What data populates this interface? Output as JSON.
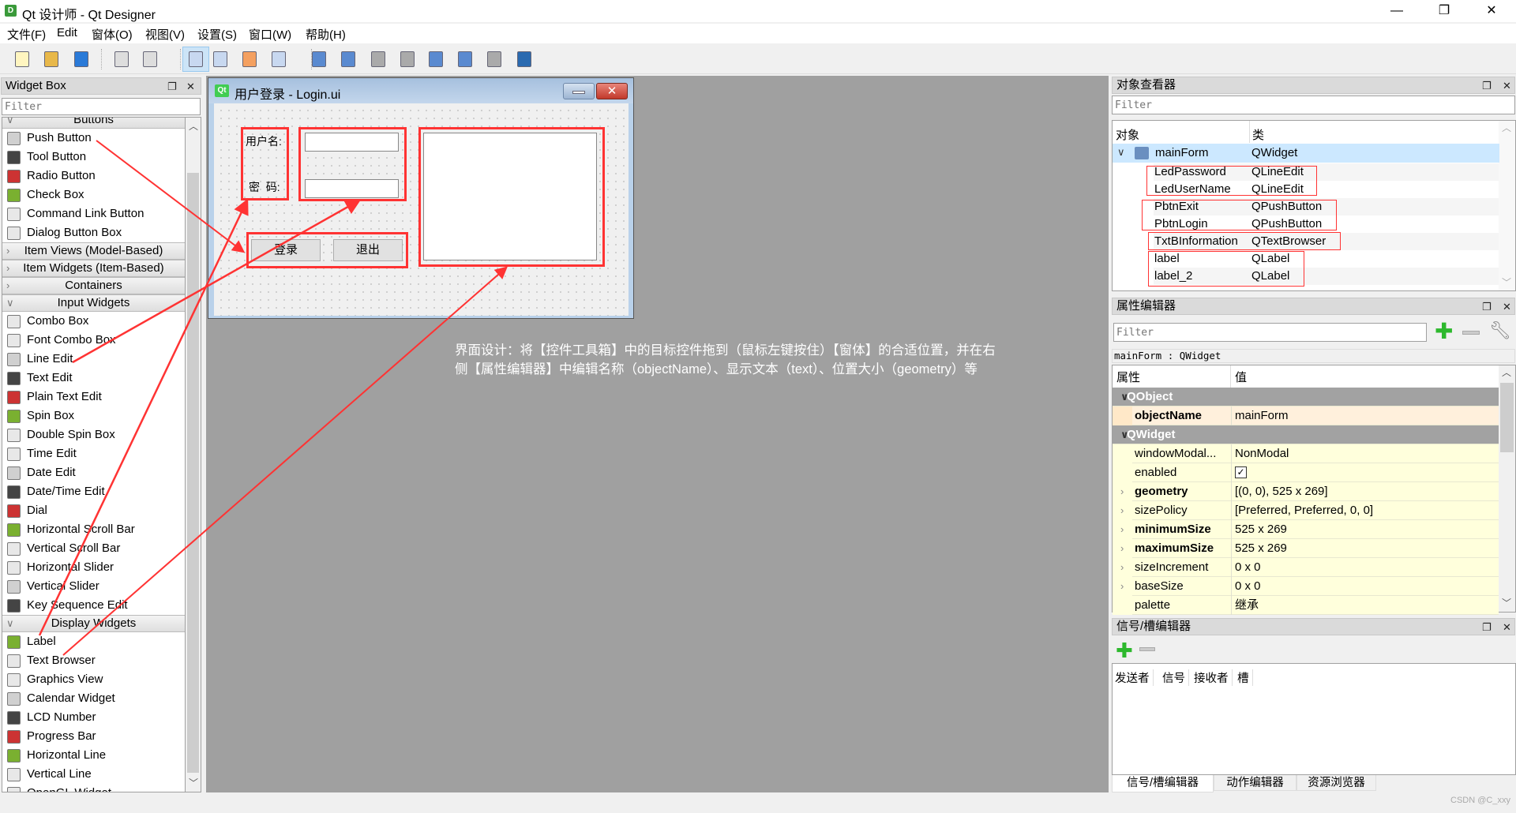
{
  "window": {
    "title": "Qt 设计师 - Qt Designer",
    "icon": "qt-designer-icon",
    "minimize": "—",
    "restore": "❐",
    "close": "✕"
  },
  "menu": [
    "文件(F)",
    "Edit",
    "窗体(O)",
    "视图(V)",
    "设置(S)",
    "窗口(W)",
    "帮助(H)"
  ],
  "toolbar": [
    {
      "icon": "new-file-icon"
    },
    {
      "icon": "open-folder-icon"
    },
    {
      "icon": "save-icon"
    },
    {
      "icon": "bring-front-icon"
    },
    {
      "icon": "send-back-icon"
    },
    {
      "icon": "edit-widgets-icon",
      "active": true
    },
    {
      "icon": "edit-signals-slots-icon"
    },
    {
      "icon": "edit-buddies-icon"
    },
    {
      "icon": "edit-tab-order-icon"
    },
    {
      "icon": "layout-horizontal-icon"
    },
    {
      "icon": "layout-vertical-icon"
    },
    {
      "icon": "layout-h-splitter-icon"
    },
    {
      "icon": "layout-v-splitter-icon"
    },
    {
      "icon": "layout-grid-icon"
    },
    {
      "icon": "layout-form-icon"
    },
    {
      "icon": "break-layout-icon"
    },
    {
      "icon": "adjust-size-icon"
    }
  ],
  "widget_box": {
    "title": "Widget Box",
    "filter_placeholder": "Filter",
    "items": [
      {
        "cat": "Buttons",
        "open": true
      },
      {
        "label": "Push Button",
        "icon": "push-button-icon"
      },
      {
        "label": "Tool Button",
        "icon": "tool-button-icon"
      },
      {
        "label": "Radio Button",
        "icon": "radio-button-icon"
      },
      {
        "label": "Check Box",
        "icon": "check-box-icon"
      },
      {
        "label": "Command Link Button",
        "icon": "command-link-icon"
      },
      {
        "label": "Dialog Button Box",
        "icon": "dialog-button-box-icon"
      },
      {
        "cat": "Item Views (Model-Based)",
        "open": false
      },
      {
        "cat": "Item Widgets (Item-Based)",
        "open": false
      },
      {
        "cat": "Containers",
        "open": false
      },
      {
        "cat": "Input Widgets",
        "open": true
      },
      {
        "label": "Combo Box",
        "icon": "combo-box-icon"
      },
      {
        "label": "Font Combo Box",
        "icon": "font-combo-box-icon"
      },
      {
        "label": "Line Edit",
        "icon": "line-edit-icon"
      },
      {
        "label": "Text Edit",
        "icon": "text-edit-icon"
      },
      {
        "label": "Plain Text Edit",
        "icon": "plain-text-edit-icon"
      },
      {
        "label": "Spin Box",
        "icon": "spin-box-icon"
      },
      {
        "label": "Double Spin Box",
        "icon": "double-spin-box-icon"
      },
      {
        "label": "Time Edit",
        "icon": "time-edit-icon"
      },
      {
        "label": "Date Edit",
        "icon": "date-edit-icon"
      },
      {
        "label": "Date/Time Edit",
        "icon": "date-time-edit-icon"
      },
      {
        "label": "Dial",
        "icon": "dial-icon"
      },
      {
        "label": "Horizontal Scroll Bar",
        "icon": "horizontal-scroll-bar-icon"
      },
      {
        "label": "Vertical Scroll Bar",
        "icon": "vertical-scroll-bar-icon"
      },
      {
        "label": "Horizontal Slider",
        "icon": "horizontal-slider-icon"
      },
      {
        "label": "Vertical Slider",
        "icon": "vertical-slider-icon"
      },
      {
        "label": "Key Sequence Edit",
        "icon": "key-sequence-edit-icon"
      },
      {
        "cat": "Display Widgets",
        "open": true
      },
      {
        "label": "Label",
        "icon": "label-icon"
      },
      {
        "label": "Text Browser",
        "icon": "text-browser-icon"
      },
      {
        "label": "Graphics View",
        "icon": "graphics-view-icon"
      },
      {
        "label": "Calendar Widget",
        "icon": "calendar-icon"
      },
      {
        "label": "LCD Number",
        "icon": "lcd-number-icon"
      },
      {
        "label": "Progress Bar",
        "icon": "progress-bar-icon"
      },
      {
        "label": "Horizontal Line",
        "icon": "horizontal-line-icon"
      },
      {
        "label": "Vertical Line",
        "icon": "vertical-line-icon"
      },
      {
        "label": "OpenGL Widget",
        "icon": "opengl-widget-icon"
      }
    ]
  },
  "form": {
    "title": "用户登录 - Login.ui",
    "username_label": "用户名:",
    "password_label": "密  码:",
    "login_button": "登录",
    "exit_button": "退出"
  },
  "annotation": {
    "line1": "界面设计：将【控件工具箱】中的目标控件拖到（鼠标左键按住）【窗体】的合适位置，并在右",
    "line2": "侧【属性编辑器】中编辑名称（objectName）、显示文本（text）、位置大小（geometry）等",
    "color": "#ff3333"
  },
  "object_inspector": {
    "title": "对象查看器",
    "filter_placeholder": "Filter",
    "col_object": "对象",
    "col_class": "类",
    "root": {
      "name": "mainForm",
      "class": "QWidget"
    },
    "children": [
      {
        "name": "LedPassword",
        "class": "QLineEdit"
      },
      {
        "name": "LedUserName",
        "class": "QLineEdit"
      },
      {
        "name": "PbtnExit",
        "class": "QPushButton"
      },
      {
        "name": "PbtnLogin",
        "class": "QPushButton"
      },
      {
        "name": "TxtBInformation",
        "class": "QTextBrowser"
      },
      {
        "name": "label",
        "class": "QLabel"
      },
      {
        "name": "label_2",
        "class": "QLabel"
      }
    ]
  },
  "property_editor": {
    "title": "属性编辑器",
    "filter_placeholder": "Filter",
    "context": "mainForm : QWidget",
    "col_property": "属性",
    "col_value": "值",
    "rows": [
      {
        "group": "QObject"
      },
      {
        "name": "objectName",
        "value": "mainForm",
        "bold": true,
        "style": "orange"
      },
      {
        "group": "QWidget"
      },
      {
        "name": "windowModal...",
        "value": "NonModal"
      },
      {
        "name": "enabled",
        "checkbox": true,
        "checked": true
      },
      {
        "name": "geometry",
        "value": "[(0, 0), 525 x 269]",
        "bold": true,
        "expand": true
      },
      {
        "name": "sizePolicy",
        "value": "[Preferred, Preferred, 0, 0]",
        "expand": true
      },
      {
        "name": "minimumSize",
        "value": "525 x 269",
        "bold": true,
        "expand": true
      },
      {
        "name": "maximumSize",
        "value": "525 x 269",
        "bold": true,
        "expand": true
      },
      {
        "name": "sizeIncrement",
        "value": "0 x 0",
        "expand": true
      },
      {
        "name": "baseSize",
        "value": "0 x 0",
        "expand": true
      },
      {
        "name": "palette",
        "value": "继承"
      }
    ]
  },
  "signal_editor": {
    "title": "信号/槽编辑器",
    "columns": [
      "发送者",
      "信号",
      "接收者",
      "槽"
    ],
    "tabs": [
      "信号/槽编辑器",
      "动作编辑器",
      "资源浏览器"
    ],
    "active_tab": 0
  },
  "watermark": "CSDN @C_xxy"
}
